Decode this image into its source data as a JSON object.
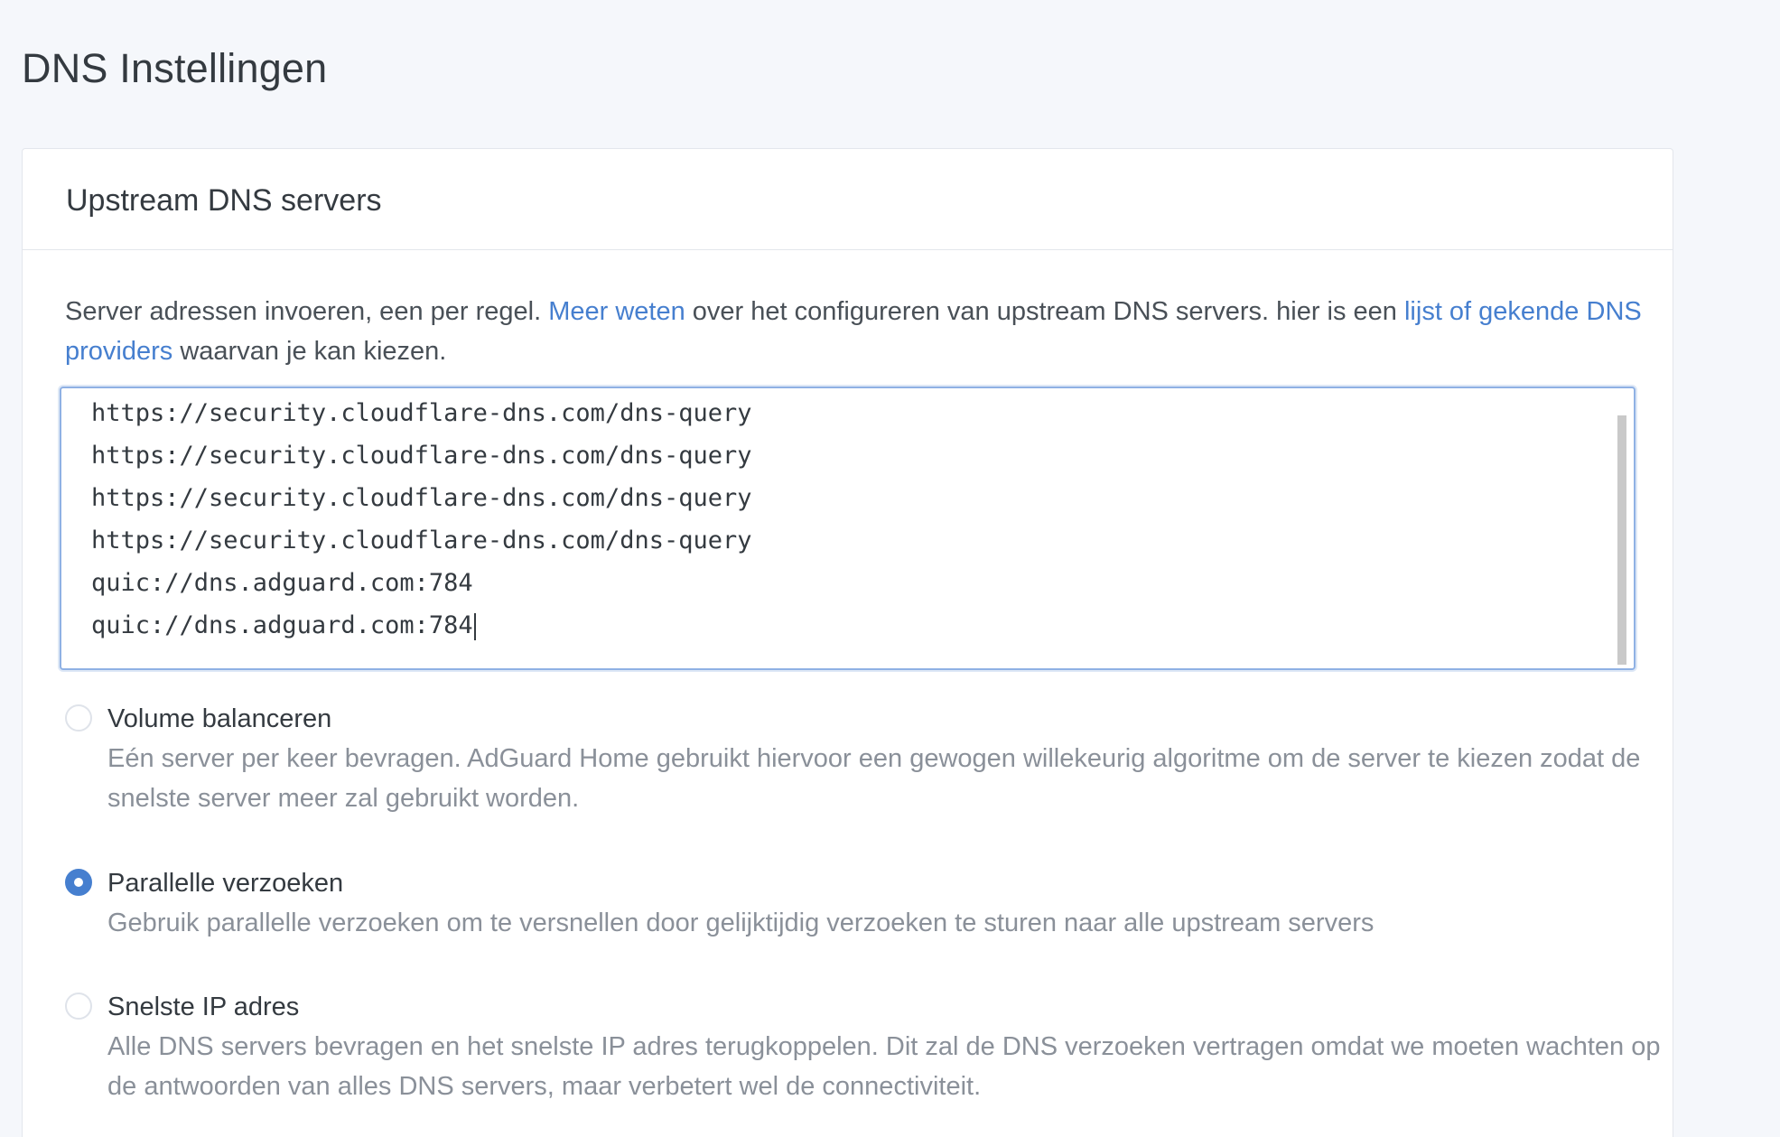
{
  "page": {
    "title": "DNS Instellingen"
  },
  "card": {
    "title": "Upstream DNS servers",
    "description": {
      "text_1": "Server adressen invoeren, een per regel. ",
      "link_1": "Meer weten",
      "text_2": " over het configureren van upstream DNS servers. hier is een ",
      "link_2": "lijst of gekende DNS providers",
      "text_3": " waarvan je kan kiezen."
    },
    "upstream_servers": [
      "https://security.cloudflare-dns.com/dns-query",
      "https://security.cloudflare-dns.com/dns-query",
      "https://security.cloudflare-dns.com/dns-query",
      "https://security.cloudflare-dns.com/dns-query",
      "quic://dns.adguard.com:784",
      "quic://dns.adguard.com:784"
    ],
    "modes": [
      {
        "label": "Volume balanceren",
        "description": "Eén server per keer bevragen. AdGuard Home gebruikt hiervoor een gewogen willekeurig algoritme om de server te kiezen zodat de snelste server meer zal gebruikt worden.",
        "checked": false
      },
      {
        "label": "Parallelle verzoeken",
        "description": "Gebruik parallelle verzoeken om te versnellen door gelijktijdig verzoeken te sturen naar alle upstream servers",
        "checked": true
      },
      {
        "label": "Snelste IP adres",
        "description": "Alle DNS servers bevragen en het snelste IP adres terugkoppelen. Dit zal de DNS verzoeken vertragen omdat we moeten wachten op de antwoorden van alles DNS servers, maar verbetert wel de connectiviteit.",
        "checked": false
      }
    ]
  },
  "colors": {
    "accent": "#467fcf",
    "text": "#495057",
    "muted": "#8a9099",
    "background": "#f5f7fb"
  }
}
